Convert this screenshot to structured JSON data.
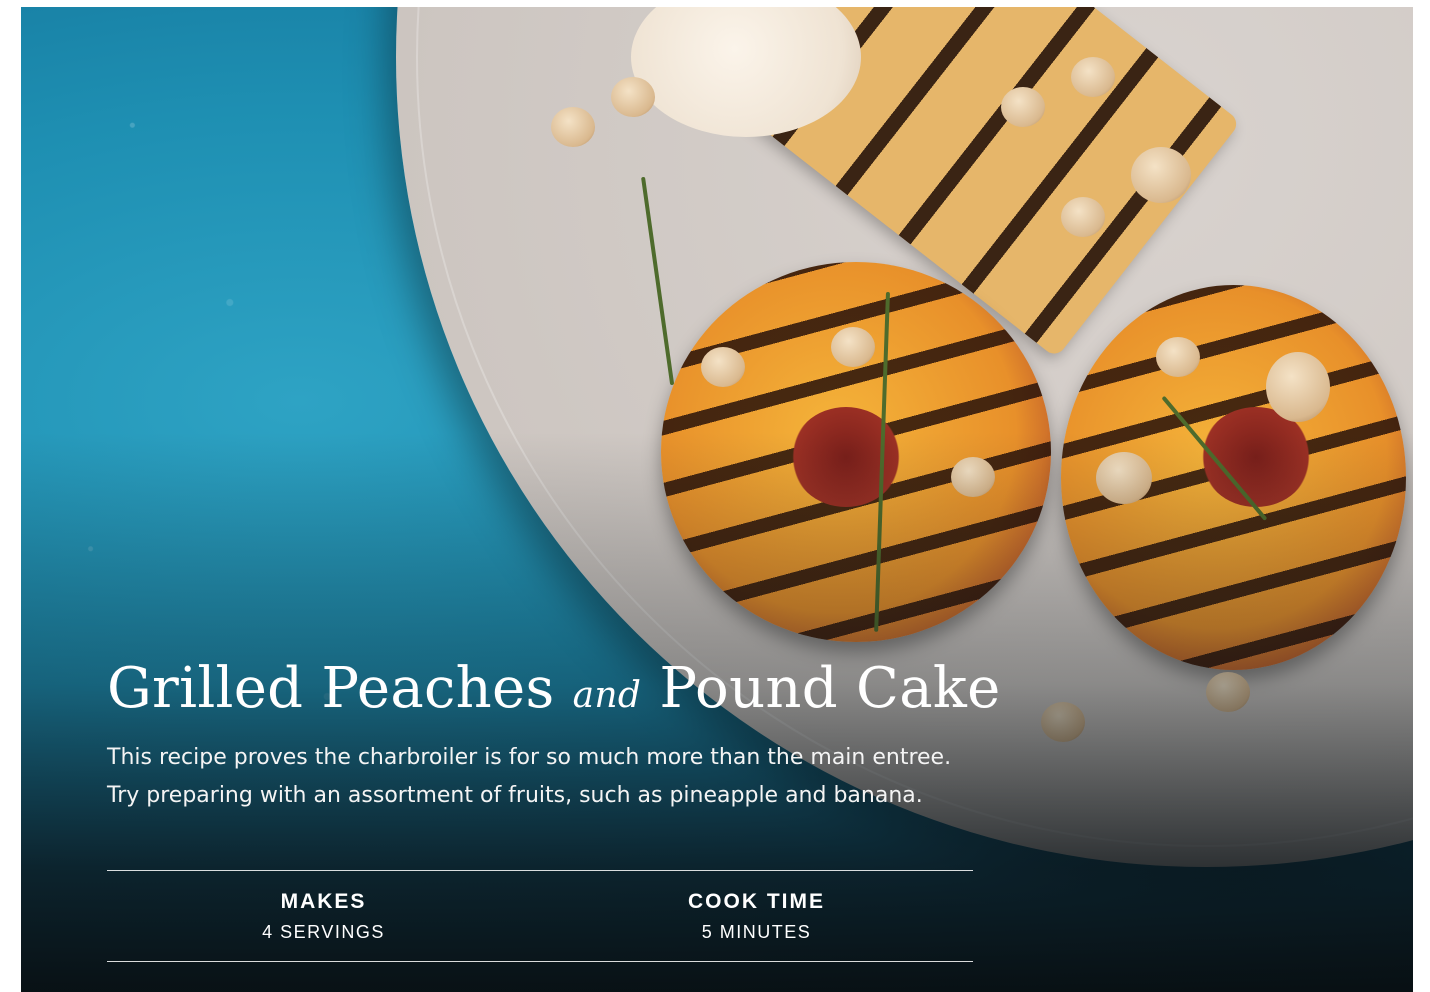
{
  "recipe": {
    "title_part1": "Grilled Peaches",
    "title_connector": "and",
    "title_part2": "Pound Cake",
    "intro_line1": "This recipe proves the charbroiler is for so much more than the main entree.",
    "intro_line2": "Try preparing with an assortment of fruits, such as pineapple and banana."
  },
  "meta": {
    "makes_label": "MAKES",
    "makes_value": "4 SERVINGS",
    "cook_label": "COOK TIME",
    "cook_value": "5 MINUTES"
  },
  "colors": {
    "background": "#1e8fb2",
    "text": "#ffffff"
  }
}
